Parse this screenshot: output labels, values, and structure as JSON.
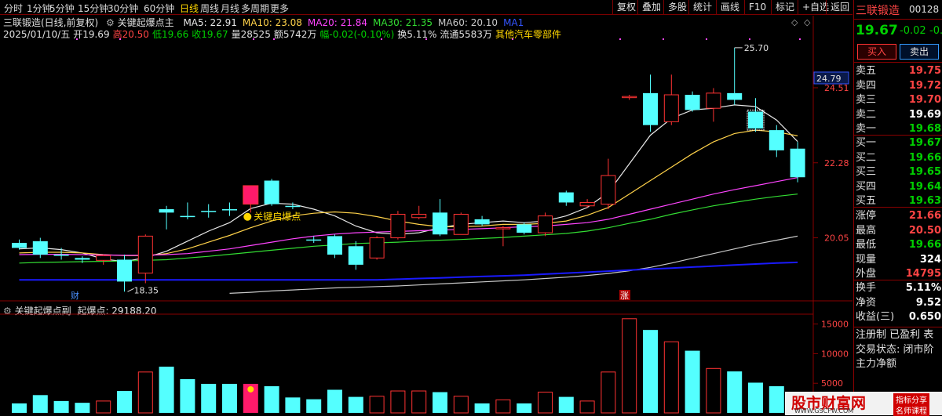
{
  "toolbar": {
    "left": [
      "分时",
      "1分钟",
      "5分钟",
      "15分钟",
      "30分钟",
      "60分钟",
      "日线",
      "周线",
      "月线",
      "多周期",
      "更多"
    ],
    "active": "日线",
    "right": [
      "复权",
      "叠加",
      "多股",
      "统计",
      "画线",
      "F10",
      "标记",
      "+自选",
      "返回"
    ]
  },
  "header": {
    "stock": "三联锻造(日线,前复权)",
    "indicator": "关键起爆点主",
    "ma": [
      {
        "label": "MA5: 22.91",
        "color": "#e8e8e8"
      },
      {
        "label": "MA10: 23.08",
        "color": "#ffd24a"
      },
      {
        "label": "MA20: 21.84",
        "color": "#ff44ff"
      },
      {
        "label": "MA30: 21.35",
        "color": "#33dd33"
      },
      {
        "label": "MA60: 20.10",
        "color": "#c8c8c8"
      },
      {
        "label": "MA1",
        "color": "#3355ff"
      }
    ],
    "info": [
      {
        "t": "2025/01/10/五",
        "c": "#e0e0e0"
      },
      {
        "t": "开19.69",
        "c": "#e0e0e0"
      },
      {
        "t": "高20.50",
        "c": "#ff4444"
      },
      {
        "t": "低19.66",
        "c": "#00d000"
      },
      {
        "t": "收19.67",
        "c": "#00d000"
      },
      {
        "t": "量28525",
        "c": "#e0e0e0"
      },
      {
        "t": "额5742万",
        "c": "#e0e0e0"
      },
      {
        "t": "幅-0.02(-0.10%)",
        "c": "#00d000"
      },
      {
        "t": "换5.11%",
        "c": "#e0e0e0"
      },
      {
        "t": "流通5583万",
        "c": "#e0e0e0"
      },
      {
        "t": "其他汽车零部件",
        "c": "#ffd700"
      }
    ]
  },
  "sub": {
    "title": "关键起爆点副",
    "value_label": "起爆点: 29188.20"
  },
  "annotations": {
    "signal": "关键启爆点",
    "low": "18.35",
    "high": "25.70",
    "cai": "财",
    "zhang": "涨"
  },
  "chart_data": {
    "type": "candlestick",
    "main": {
      "ylim": [
        18.2,
        26.0
      ],
      "y_ticks": [
        "24.79",
        "24.51",
        "22.28",
        "20.05"
      ],
      "current_price_tag": "24.79",
      "high_label": "25.70",
      "low_label": "18.35",
      "candles": [
        {
          "o": 19.9,
          "h": 20.0,
          "l": 19.7,
          "c": 19.75,
          "up": false
        },
        {
          "o": 19.55,
          "h": 20.05,
          "l": 19.45,
          "c": 19.95,
          "up": false
        },
        {
          "o": 19.55,
          "h": 19.75,
          "l": 19.4,
          "c": 19.55,
          "up": false
        },
        {
          "o": 19.45,
          "h": 19.5,
          "l": 19.3,
          "c": 19.4,
          "up": false
        },
        {
          "o": 19.38,
          "h": 19.55,
          "l": 19.25,
          "c": 19.52,
          "up": true
        },
        {
          "o": 19.4,
          "h": 19.55,
          "l": 18.45,
          "c": 18.75,
          "up": false
        },
        {
          "o": 19.0,
          "h": 20.15,
          "l": 18.7,
          "c": 20.1,
          "up": true
        },
        {
          "o": 20.9,
          "h": 21.0,
          "l": 20.3,
          "c": 20.8,
          "up": false
        },
        {
          "o": 20.7,
          "h": 21.1,
          "l": 20.6,
          "c": 20.7,
          "up": false
        },
        {
          "o": 20.85,
          "h": 21.05,
          "l": 20.65,
          "c": 20.85,
          "up": false
        },
        {
          "o": 20.9,
          "h": 21.1,
          "l": 20.7,
          "c": 20.9,
          "up": false
        },
        {
          "o": 21.05,
          "h": 21.6,
          "l": 20.8,
          "c": 21.6,
          "up": true
        },
        {
          "o": 21.75,
          "h": 21.8,
          "l": 21.0,
          "c": 21.05,
          "up": false
        },
        {
          "o": 21.0,
          "h": 21.1,
          "l": 20.9,
          "c": 21.0,
          "up": false
        },
        {
          "o": 20.0,
          "h": 20.1,
          "l": 19.9,
          "c": 20.0,
          "up": false
        },
        {
          "o": 20.1,
          "h": 20.15,
          "l": 19.45,
          "c": 19.55,
          "up": false
        },
        {
          "o": 19.8,
          "h": 19.95,
          "l": 19.1,
          "c": 19.25,
          "up": false
        },
        {
          "o": 19.45,
          "h": 20.1,
          "l": 19.4,
          "c": 20.05,
          "up": true
        },
        {
          "o": 20.05,
          "h": 20.85,
          "l": 20.0,
          "c": 20.75,
          "up": true
        },
        {
          "o": 20.65,
          "h": 21.0,
          "l": 20.6,
          "c": 20.75,
          "up": true
        },
        {
          "o": 20.8,
          "h": 21.2,
          "l": 20.1,
          "c": 20.15,
          "up": false
        },
        {
          "o": 20.15,
          "h": 20.8,
          "l": 20.15,
          "c": 20.75,
          "up": true
        },
        {
          "o": 20.6,
          "h": 20.7,
          "l": 20.4,
          "c": 20.45,
          "up": false
        },
        {
          "o": 20.35,
          "h": 20.4,
          "l": 19.8,
          "c": 20.35,
          "up": true
        },
        {
          "o": 20.45,
          "h": 20.5,
          "l": 20.15,
          "c": 20.2,
          "up": false
        },
        {
          "o": 20.2,
          "h": 20.8,
          "l": 20.1,
          "c": 20.7,
          "up": true
        },
        {
          "o": 21.4,
          "h": 21.45,
          "l": 21.0,
          "c": 21.1,
          "up": false
        },
        {
          "o": 21.0,
          "h": 21.2,
          "l": 20.95,
          "c": 21.1,
          "up": true
        },
        {
          "o": 21.05,
          "h": 22.4,
          "l": 20.9,
          "c": 21.9,
          "up": true
        },
        {
          "o": 24.25,
          "h": 24.3,
          "l": 24.15,
          "c": 24.25,
          "up": true
        },
        {
          "o": 24.35,
          "h": 24.9,
          "l": 23.2,
          "c": 23.4,
          "up": false
        },
        {
          "o": 23.5,
          "h": 24.9,
          "l": 23.4,
          "c": 24.3,
          "up": true
        },
        {
          "o": 24.3,
          "h": 24.4,
          "l": 23.8,
          "c": 23.85,
          "up": false
        },
        {
          "o": 23.9,
          "h": 24.5,
          "l": 23.5,
          "c": 24.35,
          "up": true
        },
        {
          "o": 24.35,
          "h": 25.7,
          "l": 24.0,
          "c": 24.15,
          "up": false
        },
        {
          "o": 23.8,
          "h": 24.2,
          "l": 23.2,
          "c": 23.3,
          "up": false
        },
        {
          "o": 23.25,
          "h": 23.4,
          "l": 22.45,
          "c": 22.65,
          "up": false
        },
        {
          "o": 22.7,
          "h": 22.9,
          "l": 21.7,
          "c": 21.85,
          "up": false
        }
      ],
      "ma_series": [
        {
          "name": "MA5",
          "color": "#e8e8e8",
          "values": [
            19.72,
            19.75,
            19.7,
            19.6,
            19.42,
            19.34,
            19.46,
            19.65,
            19.95,
            20.25,
            20.5,
            20.92,
            21.08,
            21.05,
            20.9,
            20.7,
            20.4,
            20.2,
            20.15,
            20.2,
            20.35,
            20.45,
            20.5,
            20.55,
            20.5,
            20.55,
            20.7,
            20.95,
            21.4,
            22.25,
            23.1,
            23.6,
            23.85,
            23.9,
            24.0,
            23.95,
            23.55,
            22.91
          ]
        },
        {
          "name": "MA10",
          "color": "#ffd24a",
          "values": [
            19.6,
            19.62,
            19.62,
            19.6,
            19.55,
            19.52,
            19.52,
            19.58,
            19.72,
            19.92,
            20.12,
            20.35,
            20.55,
            20.7,
            20.78,
            20.82,
            20.78,
            20.68,
            20.55,
            20.45,
            20.38,
            20.38,
            20.4,
            20.45,
            20.45,
            20.48,
            20.55,
            20.72,
            20.95,
            21.35,
            21.75,
            22.15,
            22.55,
            22.9,
            23.15,
            23.25,
            23.2,
            23.08
          ]
        },
        {
          "name": "MA20",
          "color": "#ff44ff",
          "values": [
            19.55,
            19.56,
            19.56,
            19.55,
            19.54,
            19.53,
            19.53,
            19.55,
            19.58,
            19.65,
            19.72,
            19.82,
            19.92,
            20.02,
            20.1,
            20.16,
            20.2,
            20.22,
            20.24,
            20.26,
            20.28,
            20.3,
            20.32,
            20.35,
            20.38,
            20.4,
            20.45,
            20.5,
            20.6,
            20.75,
            20.9,
            21.05,
            21.2,
            21.35,
            21.48,
            21.6,
            21.72,
            21.84
          ]
        },
        {
          "name": "MA30",
          "color": "#33dd33",
          "values": [
            19.3,
            19.32,
            19.33,
            19.34,
            19.35,
            19.36,
            19.38,
            19.4,
            19.45,
            19.5,
            19.56,
            19.62,
            19.68,
            19.74,
            19.8,
            19.84,
            19.88,
            19.9,
            19.92,
            19.95,
            19.98,
            20.0,
            20.03,
            20.06,
            20.1,
            20.14,
            20.18,
            20.25,
            20.35,
            20.48,
            20.6,
            20.75,
            20.88,
            21.0,
            21.1,
            21.2,
            21.28,
            21.35
          ]
        },
        {
          "name": "MA60",
          "color": "#c8c8c8",
          "values": [
            null,
            null,
            null,
            null,
            null,
            null,
            null,
            null,
            null,
            null,
            18.4,
            18.43,
            18.47,
            18.5,
            18.53,
            18.56,
            18.58,
            18.6,
            18.62,
            18.65,
            18.68,
            18.71,
            18.74,
            18.77,
            18.8,
            18.84,
            18.88,
            18.93,
            18.99,
            19.07,
            19.17,
            19.3,
            19.44,
            19.58,
            19.72,
            19.86,
            19.98,
            20.1
          ]
        },
        {
          "name": "MA1",
          "color": "#1a1aff",
          "values": [
            18.8,
            18.8,
            18.8,
            18.8,
            18.8,
            18.8,
            18.8,
            18.8,
            18.8,
            18.8,
            18.8,
            18.8,
            18.8,
            18.8,
            18.8,
            18.8,
            18.8,
            18.8,
            18.82,
            18.84,
            18.86,
            18.88,
            18.9,
            18.92,
            18.94,
            18.97,
            19.0,
            19.03,
            19.06,
            19.09,
            19.12,
            19.15,
            19.18,
            19.21,
            19.24,
            19.27,
            19.3,
            19.32
          ]
        }
      ]
    },
    "sub": {
      "ylim": [
        0,
        16800
      ],
      "y_ticks": [
        "15000",
        "10000",
        "5000"
      ],
      "bars": [
        {
          "v": 1600,
          "up": false
        },
        {
          "v": 3000,
          "up": false
        },
        {
          "v": 2000,
          "up": false
        },
        {
          "v": 1700,
          "up": false
        },
        {
          "v": 2000,
          "up": true
        },
        {
          "v": 3700,
          "up": false
        },
        {
          "v": 6900,
          "up": true
        },
        {
          "v": 7800,
          "up": false
        },
        {
          "v": 5700,
          "up": false
        },
        {
          "v": 4900,
          "up": false
        },
        {
          "v": 4900,
          "up": false
        },
        {
          "v": 4900,
          "up": true,
          "signal": true
        },
        {
          "v": 4500,
          "up": false
        },
        {
          "v": 2600,
          "up": false
        },
        {
          "v": 2300,
          "up": false
        },
        {
          "v": 3900,
          "up": false
        },
        {
          "v": 2700,
          "up": false
        },
        {
          "v": 2800,
          "up": true
        },
        {
          "v": 3700,
          "up": true
        },
        {
          "v": 3700,
          "up": true
        },
        {
          "v": 3500,
          "up": false
        },
        {
          "v": 2800,
          "up": true
        },
        {
          "v": 1600,
          "up": false
        },
        {
          "v": 2200,
          "up": true
        },
        {
          "v": 1600,
          "up": false
        },
        {
          "v": 3500,
          "up": true
        },
        {
          "v": 2700,
          "up": false
        },
        {
          "v": 2000,
          "up": true
        },
        {
          "v": 6900,
          "up": true
        },
        {
          "v": 15900,
          "up": true
        },
        {
          "v": 14000,
          "up": false
        },
        {
          "v": 12000,
          "up": true
        },
        {
          "v": 10500,
          "up": false
        },
        {
          "v": 7500,
          "up": true
        },
        {
          "v": 7000,
          "up": false
        },
        {
          "v": 5100,
          "up": false
        },
        {
          "v": 4500,
          "up": false
        },
        {
          "v": 3000,
          "up": false
        }
      ]
    }
  },
  "right_panel": {
    "name": "三联锻造",
    "code": "00128",
    "price": "19.67",
    "change": "-0.02",
    "change_pct": "-0.",
    "buy_btn": "买入",
    "sell_btn": "卖出",
    "asks": [
      {
        "k": "卖五",
        "v": "19.75",
        "c": "#ff4444"
      },
      {
        "k": "卖四",
        "v": "19.72",
        "c": "#ff4444"
      },
      {
        "k": "卖三",
        "v": "19.70",
        "c": "#ff4444"
      },
      {
        "k": "卖二",
        "v": "19.69",
        "c": "#ffffff"
      },
      {
        "k": "卖一",
        "v": "19.68",
        "c": "#00d000"
      }
    ],
    "bids": [
      {
        "k": "买一",
        "v": "19.67",
        "c": "#00d000"
      },
      {
        "k": "买二",
        "v": "19.66",
        "c": "#00d000"
      },
      {
        "k": "买三",
        "v": "19.65",
        "c": "#00d000"
      },
      {
        "k": "买四",
        "v": "19.64",
        "c": "#00d000"
      },
      {
        "k": "买五",
        "v": "19.63",
        "c": "#00d000"
      }
    ],
    "stats1": [
      {
        "k": "涨停",
        "v": "21.66",
        "c": "#ff4444"
      },
      {
        "k": "最高",
        "v": "20.50",
        "c": "#ff4444"
      },
      {
        "k": "最低",
        "v": "19.66",
        "c": "#00d000"
      },
      {
        "k": "现量",
        "v": "324",
        "c": "#ffffff"
      },
      {
        "k": "外盘",
        "v": "14795",
        "c": "#ff4444"
      }
    ],
    "stats2": [
      {
        "k": "换手",
        "v": "5.11%",
        "c": "#ffffff"
      },
      {
        "k": "净资",
        "v": "9.52",
        "c": "#ffffff"
      },
      {
        "k": "收益(三)",
        "v": "0.650",
        "c": "#ffffff"
      }
    ],
    "foot": [
      {
        "t": "注册制 已盈利 表",
        "c": "#e0e0e0"
      },
      {
        "t": "交易状态: 闭市阶",
        "c": "#e0e0e0"
      },
      {
        "t": "主力净额",
        "c": "#e0e0e0"
      }
    ]
  },
  "watermark": {
    "main": "股市财富网",
    "url": "WWW.GSCFW.COM",
    "tag1": "指标分享",
    "tag2": "名师课程"
  }
}
